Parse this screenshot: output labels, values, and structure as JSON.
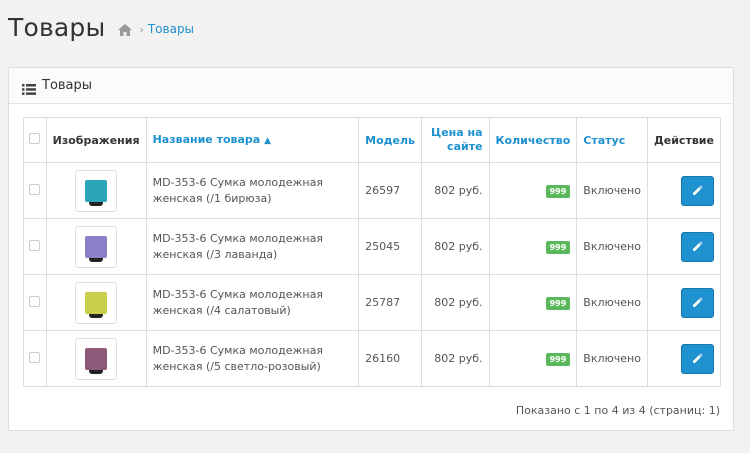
{
  "header": {
    "title": "Товары",
    "breadcrumb": "Товары"
  },
  "panel": {
    "title": "Товары"
  },
  "table": {
    "columns": {
      "images": "Изображения",
      "name": "Название товара",
      "model": "Модель",
      "price": "Цена на сайте",
      "quantity": "Количество",
      "status": "Статус",
      "action": "Действие"
    },
    "rows": [
      {
        "name": "MD-353-6 Сумка молодежная женская (/1 бирюза)",
        "model": "26597",
        "price": "802 руб.",
        "quantity": "999",
        "status": "Включено",
        "image_color": "#2aa6b8"
      },
      {
        "name": "MD-353-6 Сумка молодежная женская (/3 лаванда)",
        "model": "25045",
        "price": "802 руб.",
        "quantity": "999",
        "status": "Включено",
        "image_color": "#8b7fc7"
      },
      {
        "name": "MD-353-6 Сумка молодежная женская (/4 салатовый)",
        "model": "25787",
        "price": "802 руб.",
        "quantity": "999",
        "status": "Включено",
        "image_color": "#c9cf4a"
      },
      {
        "name": "MD-353-6 Сумка молодежная женская (/5 светло-розовый)",
        "model": "26160",
        "price": "802 руб.",
        "quantity": "999",
        "status": "Включено",
        "image_color": "#8c5a78"
      }
    ]
  },
  "pagination": {
    "text": "Показано с 1 по 4 из 4 (страниц: 1)"
  },
  "icons": {
    "home": "home-icon",
    "list": "list-icon",
    "edit": "pencil-icon",
    "sort": "caret-up-icon"
  },
  "colors": {
    "link": "#1e91cf",
    "badge": "#5cb85c",
    "button": "#1e91cf"
  }
}
